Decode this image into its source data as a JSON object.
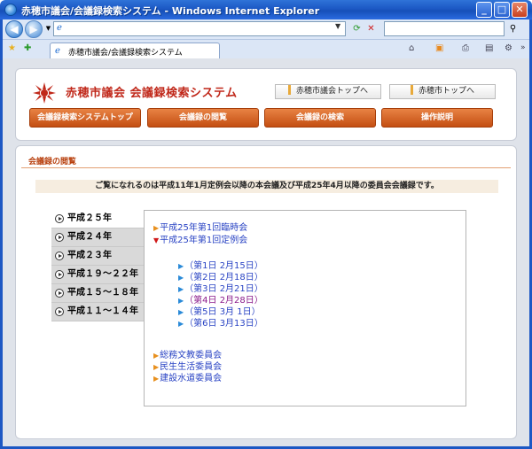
{
  "window": {
    "title": "赤穂市議会/会議録検索システム - Windows Internet Explorer"
  },
  "browser": {
    "tab_label": "赤穂市議会/会議録検索システム"
  },
  "header": {
    "site_title": "赤穂市議会  会議録検索システム",
    "links": [
      "赤穂市議会トップへ",
      "赤穂市トップへ"
    ],
    "nav": [
      "会議録検索システムトップ",
      "会議録の閲覧",
      "会議録の検索",
      "操作説明"
    ]
  },
  "main": {
    "section_title": "会議録の閲覧",
    "notice": "ご覧になれるのは平成11年1月定例会以降の本会議及び平成25年4月以降の委員会会議録です。",
    "years": [
      "平成２５年",
      "平成２４年",
      "平成２３年",
      "平成１９～２２年",
      "平成１５～１８年",
      "平成１１～１４年"
    ],
    "sessions": [
      "平成25年第1回臨時会",
      "平成25年第1回定例会"
    ],
    "days": [
      "（第1日  2月15日）",
      "（第2日  2月18日）",
      "（第3日  2月21日）",
      "（第4日  2月28日）",
      "（第5日  3月 1日）",
      "（第6日  3月13日）"
    ],
    "committees": [
      "総務文教委員会",
      "民生生活委員会",
      "建設水道委員会"
    ]
  },
  "colors": {
    "title_red": "#c0281a",
    "nav_orange": "#d4621f"
  }
}
